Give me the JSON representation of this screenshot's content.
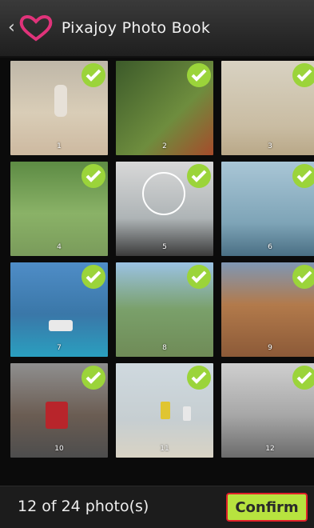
{
  "header": {
    "back_icon": "chevron-left-icon",
    "logo": "heart-logo-icon",
    "title": "Pixajoy Photo Book"
  },
  "photos": [
    {
      "num": "1",
      "selected": true
    },
    {
      "num": "2",
      "selected": true
    },
    {
      "num": "3",
      "selected": true
    },
    {
      "num": "4",
      "selected": true
    },
    {
      "num": "5",
      "selected": true
    },
    {
      "num": "6",
      "selected": true
    },
    {
      "num": "7",
      "selected": true
    },
    {
      "num": "8",
      "selected": true
    },
    {
      "num": "9",
      "selected": true
    },
    {
      "num": "10",
      "selected": true
    },
    {
      "num": "11",
      "selected": true
    },
    {
      "num": "12",
      "selected": true
    }
  ],
  "footer": {
    "count_text": "12 of 24 photo(s)",
    "confirm_label": "Confirm"
  },
  "colors": {
    "accent": "#b7e33f",
    "check": "#9bd43a",
    "logo": "#e0337a"
  }
}
